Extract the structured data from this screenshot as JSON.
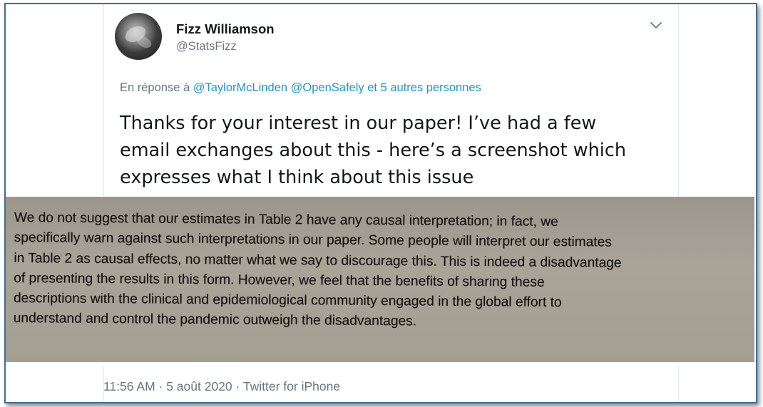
{
  "author": {
    "name": "Fizz Williamson",
    "handle": "@StatsFizz"
  },
  "icons": {
    "menu": "chevron-down-icon",
    "avatar": "profile-photo"
  },
  "reply": {
    "prefix": "En réponse à",
    "mentions": [
      "@TaylorMcLinden",
      "@OpenSafely"
    ],
    "others": "et 5 autres personnes"
  },
  "tweet": {
    "lines": [
      "Thanks for your interest in our paper! I’ve had a few",
      "email exchanges about this - here’s a screenshot which",
      "expresses what I think about this issue"
    ]
  },
  "image_text": {
    "lines": [
      "We do not suggest that our estimates in Table 2 have any causal interpretation; in fact, we",
      "specifically warn against such interpretations in our paper. Some people will interpret our estimates",
      "in Table 2 as causal effects, no matter what we say to discourage this. This is indeed a disadvantage",
      "of presenting the results in this form. However, we feel that the benefits of sharing these",
      "descriptions with the clinical and epidemiological community engaged in the global effort to",
      "understand and control the pandemic outweigh the disadvantages."
    ]
  },
  "meta": {
    "time": "11:56 AM",
    "sep1": " · ",
    "date": "5 août 2020",
    "sep2": " · ",
    "source": "Twitter for iPhone"
  },
  "colors": {
    "frame_border": "#3f6f9a",
    "link": "#1b95e0",
    "muted": "#657786",
    "text": "#14171a"
  }
}
